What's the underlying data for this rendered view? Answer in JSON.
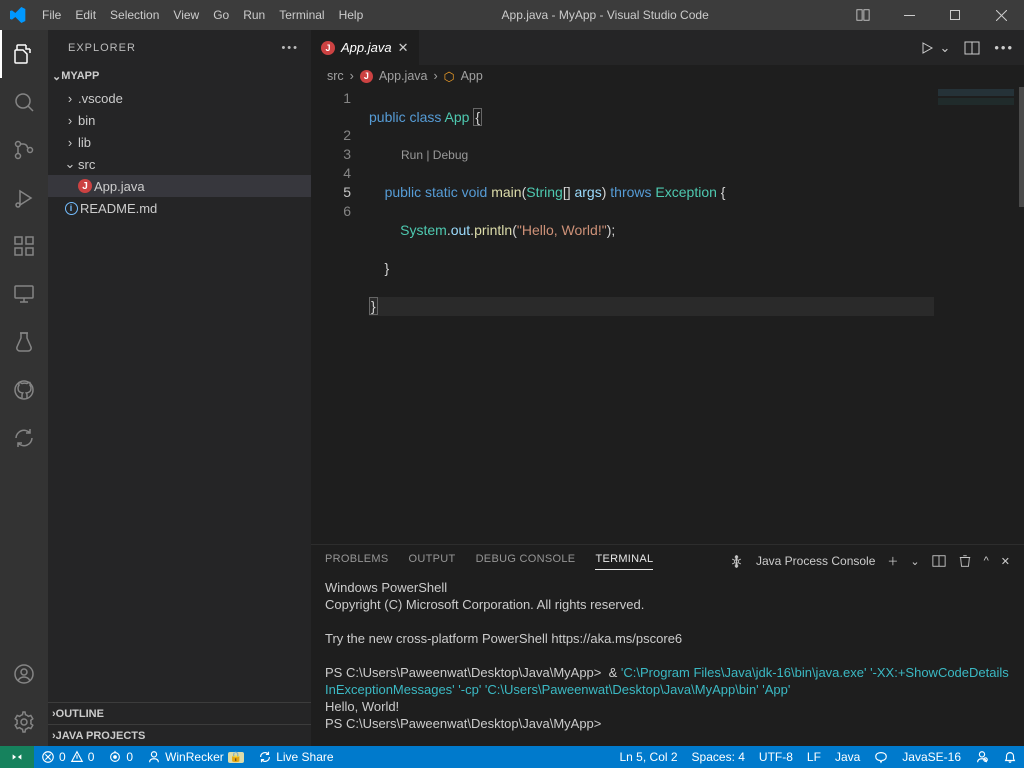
{
  "titlebar": {
    "menu": [
      "File",
      "Edit",
      "Selection",
      "View",
      "Go",
      "Run",
      "Terminal",
      "Help"
    ],
    "title": "App.java - MyApp - Visual Studio Code"
  },
  "sidebar": {
    "header": "EXPLORER",
    "project": "MYAPP",
    "tree": [
      {
        "label": ".vscode",
        "kind": "folder",
        "expanded": false,
        "depth": 1
      },
      {
        "label": "bin",
        "kind": "folder",
        "expanded": false,
        "depth": 1
      },
      {
        "label": "lib",
        "kind": "folder",
        "expanded": false,
        "depth": 1
      },
      {
        "label": "src",
        "kind": "folder",
        "expanded": true,
        "depth": 1
      },
      {
        "label": "App.java",
        "kind": "java-err",
        "depth": 2,
        "selected": true
      },
      {
        "label": "README.md",
        "kind": "info",
        "depth": 1
      }
    ],
    "sections": [
      "OUTLINE",
      "JAVA PROJECTS"
    ]
  },
  "tab": {
    "filename": "App.java"
  },
  "breadcrumb": {
    "parts": [
      "src",
      "App.java",
      "App"
    ]
  },
  "codelens": "Run | Debug",
  "code_lines": [
    "1",
    "2",
    "3",
    "4",
    "5",
    "6"
  ],
  "code": {
    "l1a": "public",
    "l1b": "class",
    "l1c": "App",
    "l1d": "{",
    "l2a": "public",
    "l2b": "static",
    "l2c": "void",
    "l2d": "main",
    "l2e": "(",
    "l2f": "String",
    "l2g": "[] ",
    "l2h": "args",
    "l2i": ") ",
    "l2j": "throws",
    "l2k": "Exception",
    "l2l": " {",
    "l3a": "System",
    "l3b": ".",
    "l3c": "out",
    "l3d": ".",
    "l3e": "println",
    "l3f": "(",
    "l3g": "\"Hello, World!\"",
    "l3h": ");",
    "l4": "    }",
    "l5": "}"
  },
  "panel": {
    "tabs": [
      "PROBLEMS",
      "OUTPUT",
      "DEBUG CONSOLE",
      "TERMINAL"
    ],
    "active": "TERMINAL",
    "console_label": "Java Process Console",
    "terminal": {
      "l1": "Windows PowerShell",
      "l2": "Copyright (C) Microsoft Corporation. All rights reserved.",
      "l3": "Try the new cross-platform PowerShell https://aka.ms/pscore6",
      "l4a": "PS C:\\Users\\Paweenwat\\Desktop\\Java\\MyApp>  & ",
      "l4b": "'C:\\Program Files\\Java\\jdk-16\\bin\\java.exe' '-XX:+ShowCodeDetailsInExceptionMessages' '-cp' 'C:\\Users\\Paweenwat\\Desktop\\Java\\MyApp\\bin' 'App'",
      "l5": "Hello, World!",
      "l6": "PS C:\\Users\\Paweenwat\\Desktop\\Java\\MyApp> "
    }
  },
  "status": {
    "errors": "0",
    "warnings": "0",
    "port": "0",
    "user": "WinRecker",
    "liveshare": "Live Share",
    "lncol": "Ln 5, Col 2",
    "spaces": "Spaces: 4",
    "encoding": "UTF-8",
    "eol": "LF",
    "lang": "Java",
    "jdk": "JavaSE-16"
  }
}
